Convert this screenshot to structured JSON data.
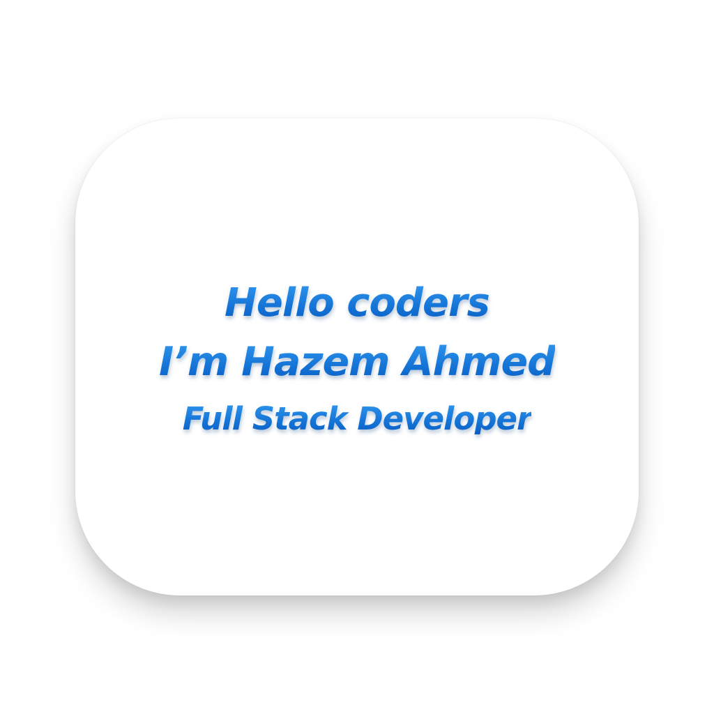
{
  "card": {
    "line_1": "Hello coders",
    "line_2": "I’m Hazem Ahmed",
    "line_3": "Full Stack Developer"
  },
  "colors": {
    "background": "#ffffff",
    "card": "#ffffff",
    "text_light": "#2f95ec",
    "text_mid": "#1676d8",
    "text_dark": "#0a5ec4"
  }
}
